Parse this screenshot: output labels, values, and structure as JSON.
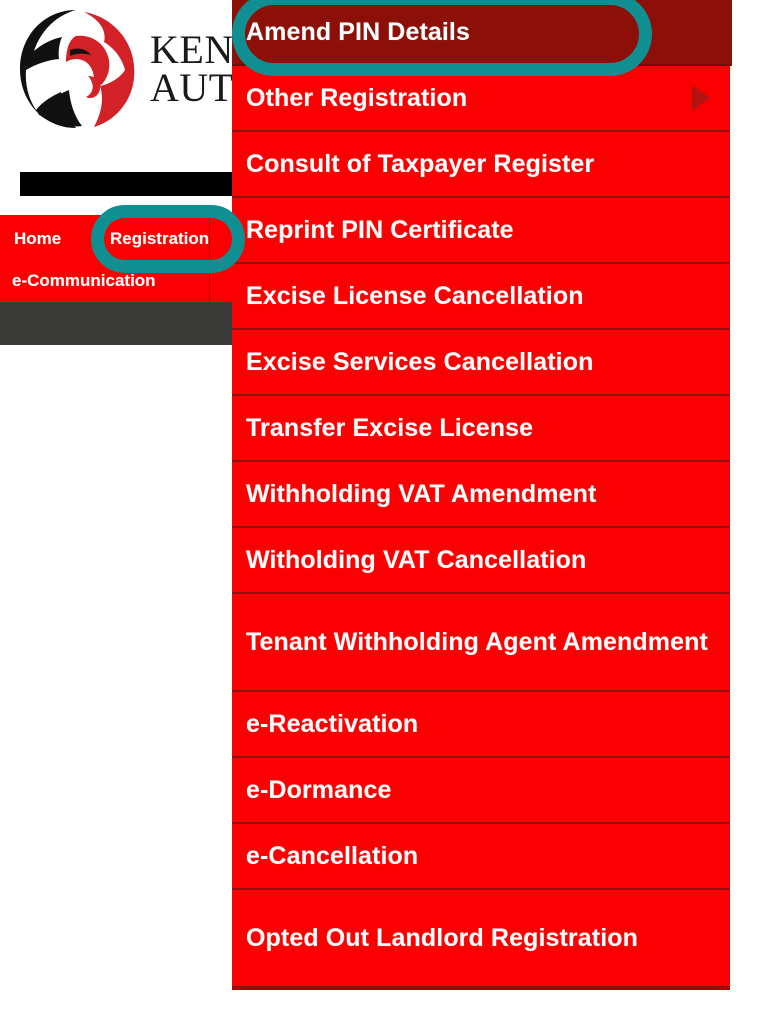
{
  "brand": {
    "name_line1": "Kenya Revenue",
    "name_line2": "Authority",
    "line1_visible": "Ken",
    "line2_visible": "Auth",
    "logo_icon": "kra-lion-logo-icon",
    "logo_colors": {
      "mane": "#111111",
      "head": "#d32128"
    }
  },
  "nav": {
    "items": [
      {
        "label": "Home",
        "id": "home"
      },
      {
        "label": "Registration",
        "id": "registration"
      },
      {
        "label": "e-Communication",
        "id": "e-communication"
      }
    ],
    "active_label": "Registration",
    "background": "#fb0000"
  },
  "dropdown": {
    "parent": "Registration",
    "background": "#fb0000",
    "hover_background": "#8c1007",
    "separator_color": "#8f0f0f",
    "items": [
      {
        "label": "Amend PIN Details",
        "lines": 1,
        "hovered": true,
        "submenu": false
      },
      {
        "label": "Other Registration",
        "lines": 1,
        "hovered": false,
        "submenu": true
      },
      {
        "label": "Consult of Taxpayer Register",
        "lines": 1,
        "hovered": false,
        "submenu": false
      },
      {
        "label": "Reprint PIN Certificate",
        "lines": 1,
        "hovered": false,
        "submenu": false
      },
      {
        "label": "Excise License Cancellation",
        "lines": 1,
        "hovered": false,
        "submenu": false
      },
      {
        "label": "Excise Services Cancellation",
        "lines": 1,
        "hovered": false,
        "submenu": false
      },
      {
        "label": "Transfer Excise License",
        "lines": 1,
        "hovered": false,
        "submenu": false
      },
      {
        "label": "Withholding VAT Amendment",
        "lines": 1,
        "hovered": false,
        "submenu": false
      },
      {
        "label": "Witholding VAT Cancellation",
        "lines": 1,
        "hovered": false,
        "submenu": false
      },
      {
        "label": "Tenant Withholding Agent Amendment",
        "lines": 2,
        "hovered": false,
        "submenu": false
      },
      {
        "label": "e-Reactivation",
        "lines": 1,
        "hovered": false,
        "submenu": false
      },
      {
        "label": "e-Dormance",
        "lines": 1,
        "hovered": false,
        "submenu": false
      },
      {
        "label": "e-Cancellation",
        "lines": 1,
        "hovered": false,
        "submenu": false
      },
      {
        "label": "Opted Out Landlord Registration",
        "lines": 2,
        "hovered": false,
        "submenu": false
      }
    ]
  },
  "annotations": {
    "color": "#108f93",
    "shapes": [
      {
        "target": "Amend PIN Details",
        "kind": "rounded-rect-highlight"
      },
      {
        "target": "Registration",
        "kind": "rounded-rect-highlight"
      }
    ]
  }
}
